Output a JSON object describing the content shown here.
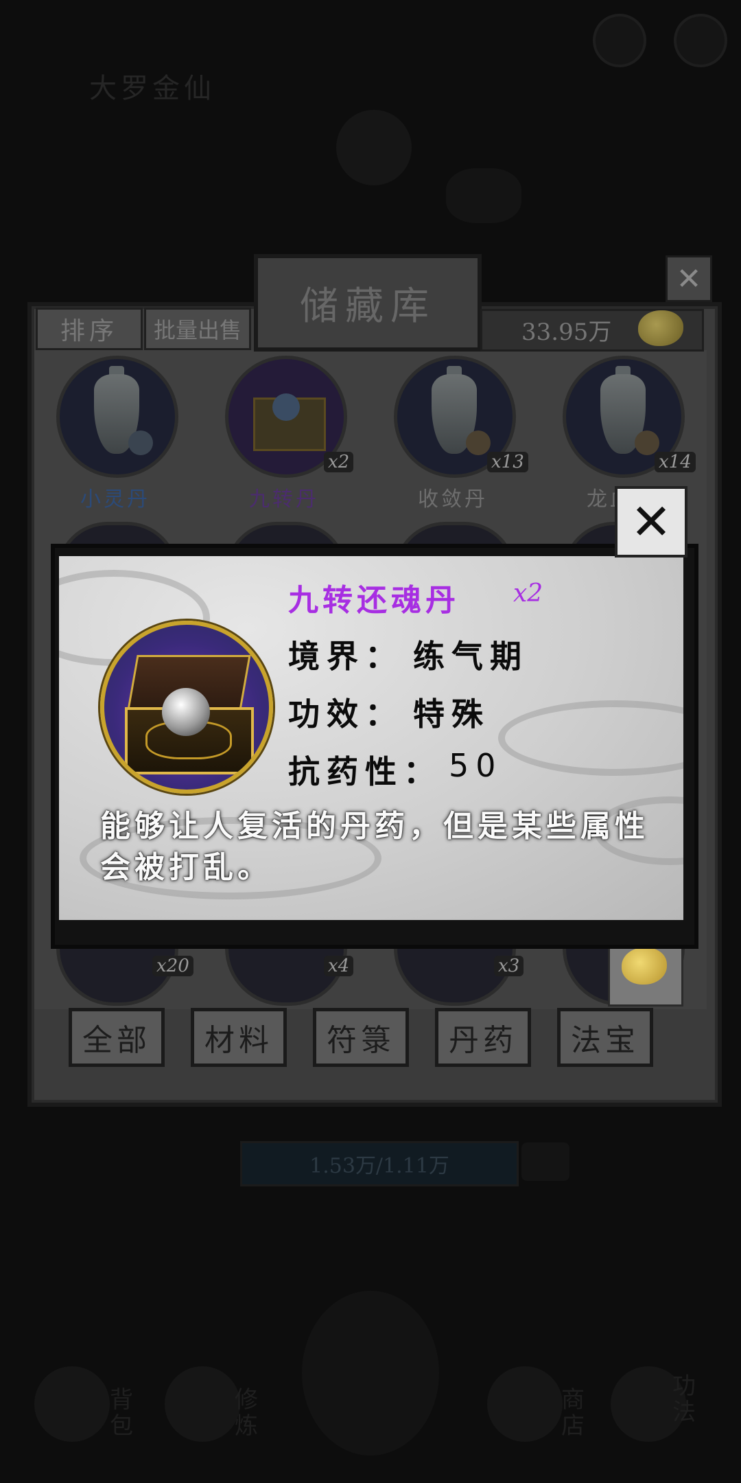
{
  "background": {
    "realm_title": "大罗金仙",
    "hp_text": "1.53万/1.11万"
  },
  "storage": {
    "title": "储藏库",
    "sort_label": "排序",
    "bulk_sell_label": "批量出售",
    "money": "33.95万",
    "items_row1": [
      {
        "name": "小灵丹",
        "count": ""
      },
      {
        "name": "九转丹",
        "count": "x2"
      },
      {
        "name": "收敛丹",
        "count": "x13"
      },
      {
        "name": "龙血丹",
        "count": "x14"
      }
    ],
    "items_row3_counts": [
      "x20",
      "x4",
      "x3",
      ""
    ],
    "filter_tabs": [
      "全部",
      "材料",
      "符箓",
      "丹药",
      "法宝"
    ]
  },
  "popup": {
    "title": "九转还魂丹",
    "count": "x2",
    "realm_label": "境界：",
    "realm_value": "练气期",
    "effect_label": "功效：",
    "effect_value": "特殊",
    "resistance_label": "抗药性：",
    "resistance_value": "50",
    "description": "能够让人复活的丹药，但是某些属性会被打乱。"
  },
  "bottom_nav": [
    {
      "label": "背包"
    },
    {
      "label": "修炼"
    },
    {
      "label": "商店"
    },
    {
      "label": "功法"
    }
  ],
  "colors": {
    "rare_purple": "#a72ee2",
    "gold": "#c9a42c"
  }
}
